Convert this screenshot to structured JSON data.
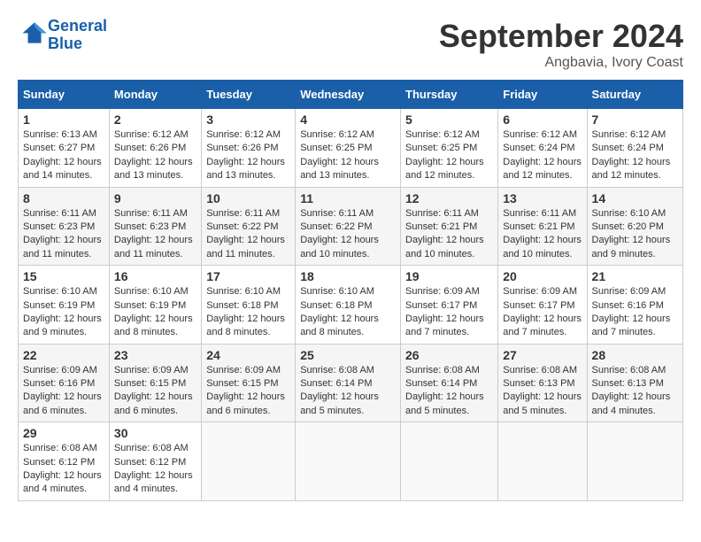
{
  "header": {
    "logo_line1": "General",
    "logo_line2": "Blue",
    "month": "September 2024",
    "location": "Angbavia, Ivory Coast"
  },
  "days_of_week": [
    "Sunday",
    "Monday",
    "Tuesday",
    "Wednesday",
    "Thursday",
    "Friday",
    "Saturday"
  ],
  "weeks": [
    [
      {
        "day": "1",
        "sunrise": "6:13 AM",
        "sunset": "6:27 PM",
        "daylight": "12 hours and 14 minutes."
      },
      {
        "day": "2",
        "sunrise": "6:12 AM",
        "sunset": "6:26 PM",
        "daylight": "12 hours and 13 minutes."
      },
      {
        "day": "3",
        "sunrise": "6:12 AM",
        "sunset": "6:26 PM",
        "daylight": "12 hours and 13 minutes."
      },
      {
        "day": "4",
        "sunrise": "6:12 AM",
        "sunset": "6:25 PM",
        "daylight": "12 hours and 13 minutes."
      },
      {
        "day": "5",
        "sunrise": "6:12 AM",
        "sunset": "6:25 PM",
        "daylight": "12 hours and 12 minutes."
      },
      {
        "day": "6",
        "sunrise": "6:12 AM",
        "sunset": "6:24 PM",
        "daylight": "12 hours and 12 minutes."
      },
      {
        "day": "7",
        "sunrise": "6:12 AM",
        "sunset": "6:24 PM",
        "daylight": "12 hours and 12 minutes."
      }
    ],
    [
      {
        "day": "8",
        "sunrise": "6:11 AM",
        "sunset": "6:23 PM",
        "daylight": "12 hours and 11 minutes."
      },
      {
        "day": "9",
        "sunrise": "6:11 AM",
        "sunset": "6:23 PM",
        "daylight": "12 hours and 11 minutes."
      },
      {
        "day": "10",
        "sunrise": "6:11 AM",
        "sunset": "6:22 PM",
        "daylight": "12 hours and 11 minutes."
      },
      {
        "day": "11",
        "sunrise": "6:11 AM",
        "sunset": "6:22 PM",
        "daylight": "12 hours and 10 minutes."
      },
      {
        "day": "12",
        "sunrise": "6:11 AM",
        "sunset": "6:21 PM",
        "daylight": "12 hours and 10 minutes."
      },
      {
        "day": "13",
        "sunrise": "6:11 AM",
        "sunset": "6:21 PM",
        "daylight": "12 hours and 10 minutes."
      },
      {
        "day": "14",
        "sunrise": "6:10 AM",
        "sunset": "6:20 PM",
        "daylight": "12 hours and 9 minutes."
      }
    ],
    [
      {
        "day": "15",
        "sunrise": "6:10 AM",
        "sunset": "6:19 PM",
        "daylight": "12 hours and 9 minutes."
      },
      {
        "day": "16",
        "sunrise": "6:10 AM",
        "sunset": "6:19 PM",
        "daylight": "12 hours and 8 minutes."
      },
      {
        "day": "17",
        "sunrise": "6:10 AM",
        "sunset": "6:18 PM",
        "daylight": "12 hours and 8 minutes."
      },
      {
        "day": "18",
        "sunrise": "6:10 AM",
        "sunset": "6:18 PM",
        "daylight": "12 hours and 8 minutes."
      },
      {
        "day": "19",
        "sunrise": "6:09 AM",
        "sunset": "6:17 PM",
        "daylight": "12 hours and 7 minutes."
      },
      {
        "day": "20",
        "sunrise": "6:09 AM",
        "sunset": "6:17 PM",
        "daylight": "12 hours and 7 minutes."
      },
      {
        "day": "21",
        "sunrise": "6:09 AM",
        "sunset": "6:16 PM",
        "daylight": "12 hours and 7 minutes."
      }
    ],
    [
      {
        "day": "22",
        "sunrise": "6:09 AM",
        "sunset": "6:16 PM",
        "daylight": "12 hours and 6 minutes."
      },
      {
        "day": "23",
        "sunrise": "6:09 AM",
        "sunset": "6:15 PM",
        "daylight": "12 hours and 6 minutes."
      },
      {
        "day": "24",
        "sunrise": "6:09 AM",
        "sunset": "6:15 PM",
        "daylight": "12 hours and 6 minutes."
      },
      {
        "day": "25",
        "sunrise": "6:08 AM",
        "sunset": "6:14 PM",
        "daylight": "12 hours and 5 minutes."
      },
      {
        "day": "26",
        "sunrise": "6:08 AM",
        "sunset": "6:14 PM",
        "daylight": "12 hours and 5 minutes."
      },
      {
        "day": "27",
        "sunrise": "6:08 AM",
        "sunset": "6:13 PM",
        "daylight": "12 hours and 5 minutes."
      },
      {
        "day": "28",
        "sunrise": "6:08 AM",
        "sunset": "6:13 PM",
        "daylight": "12 hours and 4 minutes."
      }
    ],
    [
      {
        "day": "29",
        "sunrise": "6:08 AM",
        "sunset": "6:12 PM",
        "daylight": "12 hours and 4 minutes."
      },
      {
        "day": "30",
        "sunrise": "6:08 AM",
        "sunset": "6:12 PM",
        "daylight": "12 hours and 4 minutes."
      },
      null,
      null,
      null,
      null,
      null
    ]
  ]
}
